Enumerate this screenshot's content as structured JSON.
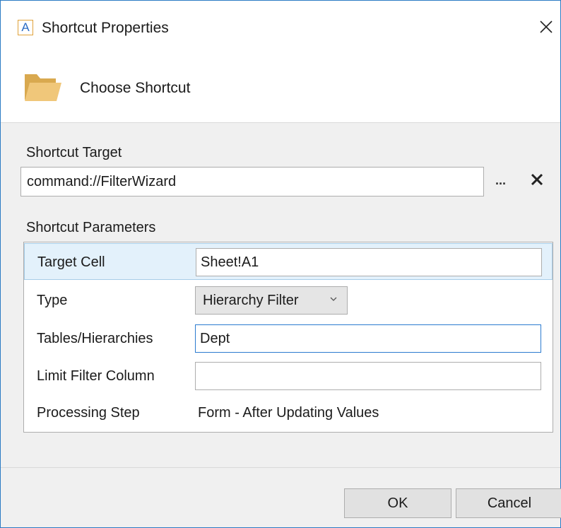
{
  "window": {
    "title": "Shortcut Properties",
    "app_icon_letter": "A",
    "app_icon": "app-a-icon",
    "close_icon": "close-icon"
  },
  "header": {
    "title": "Choose Shortcut",
    "icon": "folder-icon"
  },
  "target": {
    "label": "Shortcut Target",
    "value": "command://FilterWizard",
    "browse_label": "...",
    "clear_icon": "clear-x-icon"
  },
  "parameters": {
    "label": "Shortcut Parameters",
    "rows": [
      {
        "label": "Target Cell",
        "value": "Sheet!A1",
        "kind": "input",
        "selected": true
      },
      {
        "label": "Type",
        "value": "Hierarchy Filter",
        "kind": "select"
      },
      {
        "label": "Tables/Hierarchies",
        "value": "Dept",
        "kind": "input",
        "focused": true
      },
      {
        "label": "Limit Filter Column",
        "value": "",
        "kind": "input"
      },
      {
        "label": "Processing Step",
        "value": "Form - After Updating Values",
        "kind": "text"
      }
    ]
  },
  "footer": {
    "ok_label": "OK",
    "cancel_label": "Cancel"
  },
  "colors": {
    "accent": "#2b7bc4",
    "selected_row": "#e3f1fb",
    "folder": "#e8c074"
  }
}
